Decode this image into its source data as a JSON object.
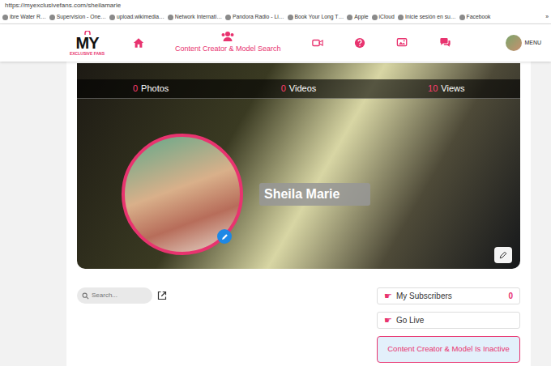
{
  "browser": {
    "url": "https://myexclusivefans.com/sheilamarie",
    "bookmarks": [
      "ibre Water R…",
      "Supervision - One…",
      "upload.wikimedia…",
      "Network Internati…",
      "Pandora Radio - Li…",
      "Book Your Long T…",
      "Apple",
      "iCloud",
      "Inicie sesión en su…",
      "Facebook"
    ],
    "more": "»"
  },
  "nav": {
    "logo": "MY",
    "logo_tagline": "EXCLUSIVE FANS",
    "search_label": "Content Creator & Model Search",
    "menu": "MENU"
  },
  "profile": {
    "stats": [
      {
        "count": "0",
        "label": "Photos"
      },
      {
        "count": "0",
        "label": "Videos"
      },
      {
        "count": "10",
        "label": "Views"
      }
    ],
    "name": "Sheila Marie"
  },
  "search": {
    "placeholder": "Search..."
  },
  "sidebar": {
    "items": [
      {
        "icon": "☛",
        "label": "My Subscribers",
        "count": "0"
      },
      {
        "icon": "☛",
        "label": "Go Live"
      }
    ],
    "status": "Content Creator & Model Is Inactive"
  }
}
